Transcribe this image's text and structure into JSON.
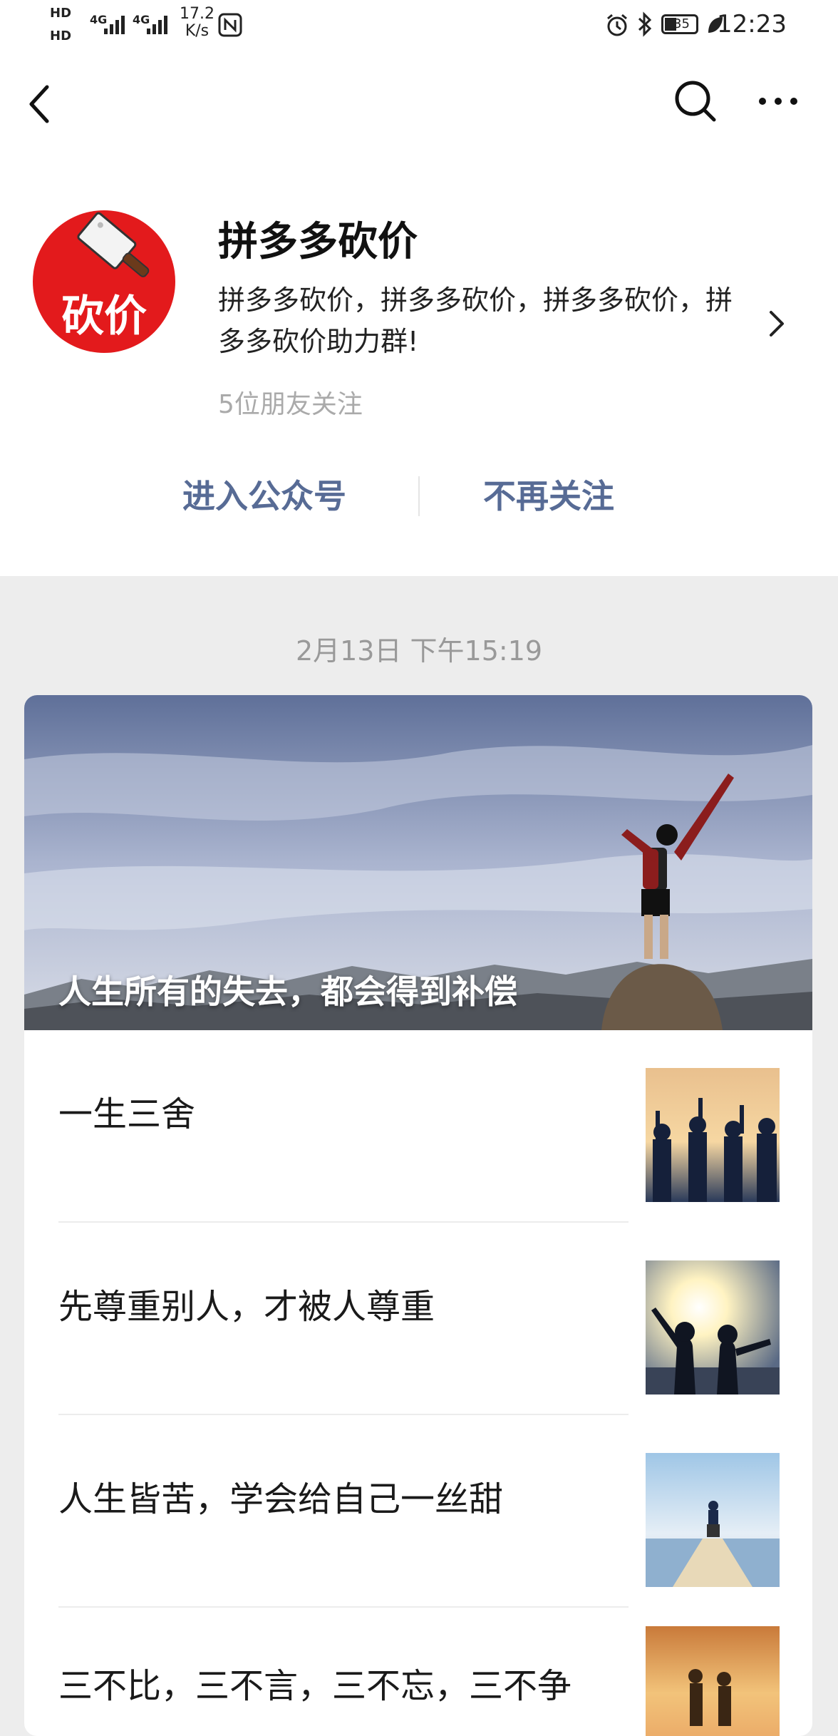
{
  "status_bar": {
    "hd1": "HD",
    "hd2": "HD",
    "sim1_net": "4G",
    "sim2_net": "4G",
    "speed_value": "17.2",
    "speed_unit": "K/s",
    "battery": "35",
    "time": "12:23"
  },
  "nav": {
    "back_icon": "chevron-left-icon",
    "search_icon": "search-icon",
    "more_icon": "more-dots-icon"
  },
  "account": {
    "avatar_text": "砍价",
    "name": "拼多多砍价",
    "description": "拼多多砍价，拼多多砍价，拼多多砍价，拼多多砍价助力群!",
    "followers": "5位朋友关注"
  },
  "actions": {
    "enter": "进入公众号",
    "unfollow": "不再关注"
  },
  "feed": {
    "date": "2月13日 下午15:19",
    "cover_title": "人生所有的失去，都会得到补偿",
    "articles": [
      {
        "title": "一生三舍"
      },
      {
        "title": "先尊重别人，才被人尊重"
      },
      {
        "title": "人生皆苦，学会给自己一丝甜"
      },
      {
        "title": "三不比，三不言，三不忘，三不争"
      }
    ]
  },
  "colors": {
    "link": "#576b95",
    "avatar_red": "#e31a1c",
    "page_bg": "#ededed"
  }
}
